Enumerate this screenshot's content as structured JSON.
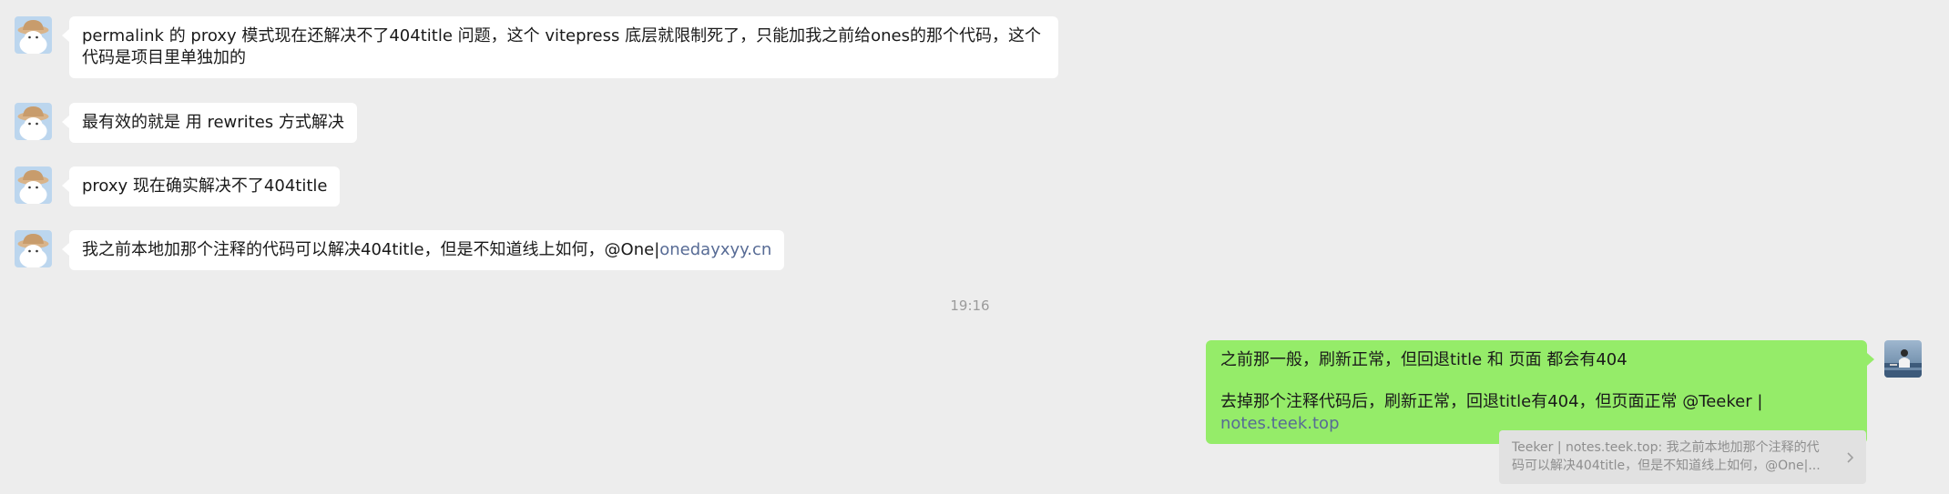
{
  "messages": [
    {
      "sender": "other",
      "text": "permalink 的 proxy 模式现在还解决不了404title 问题，这个 vitepress 底层就限制死了，只能加我之前给ones的那个代码，这个代码是项目里单独加的"
    },
    {
      "sender": "other",
      "text": "最有效的就是 用 rewrites 方式解决"
    },
    {
      "sender": "other",
      "text": "proxy 现在确实解决不了404title"
    },
    {
      "sender": "other",
      "text": "我之前本地加那个注释的代码可以解决404title，但是不知道线上如何，@One|",
      "link": "onedayxyy.cn"
    }
  ],
  "timestamp": "19:16",
  "self_message": {
    "line1": "之前那一般，刷新正常，但回退title 和 页面 都会有404",
    "line2": "去掉那个注释代码后，刷新正常，回退title有404，但页面正常 @Teeker | ",
    "link": "notes.teek.top"
  },
  "quote": {
    "text": "Teeker | notes.teek.top: 我之前本地加那个注释的代码可以解决404title，但是不知道线上如何，@One|..."
  },
  "colors": {
    "background": "#ededed",
    "bubble_other": "#ffffff",
    "bubble_self": "#95ec69",
    "link": "#576b95",
    "timestamp": "#9b9b9b"
  },
  "icons": {
    "other_avatar": "cartoon-hat-avatar-icon",
    "self_avatar": "photo-avatar-icon",
    "quote_chevron": "chevron-right-icon"
  }
}
